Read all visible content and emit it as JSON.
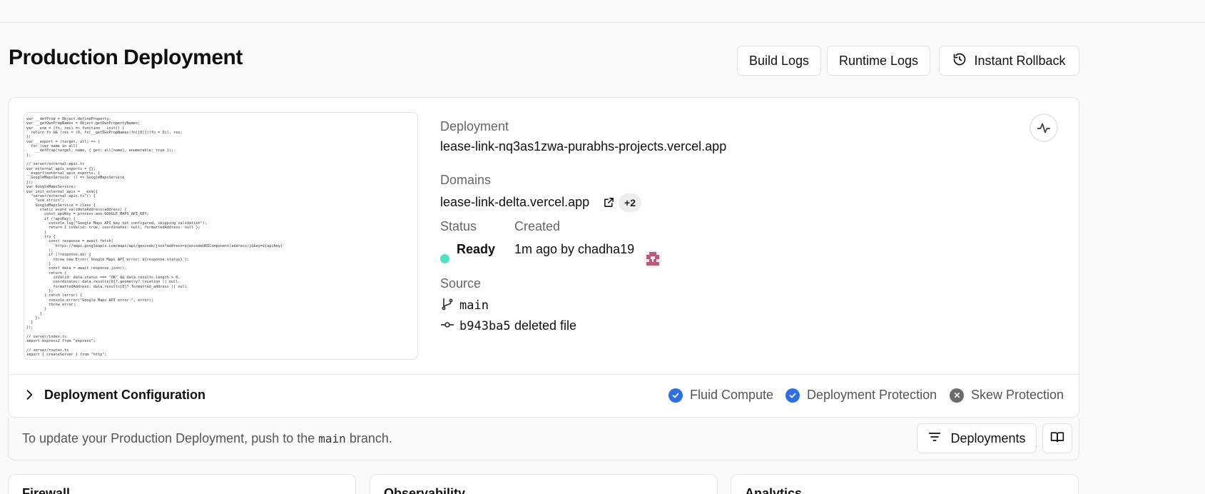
{
  "header": {
    "title": "Production Deployment",
    "buttons": {
      "build_logs": "Build Logs",
      "runtime_logs": "Runtime Logs",
      "instant_rollback": "Instant Rollback"
    }
  },
  "preview": {
    "code": "var __defProp = Object.defineProperty;\nvar __getOwnPropNames = Object.getOwnPropertyNames;\nvar __esm = (fn, res) => function __init() {\n  return fn && (res = (0, fn[__getOwnPropNames(fn)[0]])(fn = 0)), res;\n};\nvar __export = (target, all) => {\n  for (var name in all)\n    __defProp(target, name, { get: all[name], enumerable: true });\n};\n\n// server/external-apis.ts\nvar external_apis_exports = {};\n__export(external_apis_exports, {\n  GoogleMapsService: () => GoogleMapsService\n});\nvar GoogleMapsService;\nvar init_external_apis = __esm({\n  \"server/external-apis.ts\"() {\n    \"use strict\";\n    GoogleMapsService = class {\n      static async validateAddress(address) {\n        const apiKey = process.env.GOOGLE_MAPS_API_KEY;\n        if (!apiKey) {\n          console.log(\"Google Maps API key not configured, skipping validation\");\n          return { isValid: true, coordinates: null, formattedAddress: null };\n        }\n        try {\n          const response = await fetch(\n            `https://maps.googleapis.com/maps/api/geocode/json?address=${encodeURIComponent(address)}&key=${apiKey}`\n          );\n          if (!response.ok) {\n            throw new Error(`Google Maps API error: ${response.status}`);\n          }\n          const data = await response.json();\n          return {\n            isValid: data.status === \"OK\" && data.results.length > 0,\n            coordinates: data.results[0]?.geometry?.location || null,\n            formattedAddress: data.results[0]?.formatted_address || null\n          };\n        } catch (error) {\n          console.error(\"Google Maps API error:\", error);\n          throw error;\n        }\n      }\n    };\n  }\n});\n\n// server/index.ts\nimport express2 from \"express\";\n\n// server/routes.ts\nimport { createServer } from \"http\";"
  },
  "deployment": {
    "label": "Deployment",
    "url": "lease-link-nq3as1zwa-purabhs-projects.vercel.app",
    "domains_label": "Domains",
    "domain": "lease-link-delta.vercel.app",
    "domains_extra": "+2",
    "status_label": "Status",
    "status": "Ready",
    "status_color": "#50e3c2",
    "created_label": "Created",
    "created": "1m ago by chadha19",
    "source_label": "Source",
    "branch": "main",
    "commit_hash": "b943ba5",
    "commit_message": "deleted file"
  },
  "config": {
    "label": "Deployment Configuration",
    "features": [
      {
        "label": "Fluid Compute",
        "enabled": true
      },
      {
        "label": "Deployment Protection",
        "enabled": true
      },
      {
        "label": "Skew Protection",
        "enabled": false
      }
    ],
    "enabled_color": "#2f6fe4",
    "disabled_color": "#6b6b6b"
  },
  "footer": {
    "text_before": "To update your Production Deployment, push to the",
    "branch": "main",
    "text_after": "branch.",
    "deployments_button": "Deployments"
  },
  "panels": {
    "firewall": "Firewall",
    "observability": "Observability",
    "analytics": "Analytics"
  }
}
